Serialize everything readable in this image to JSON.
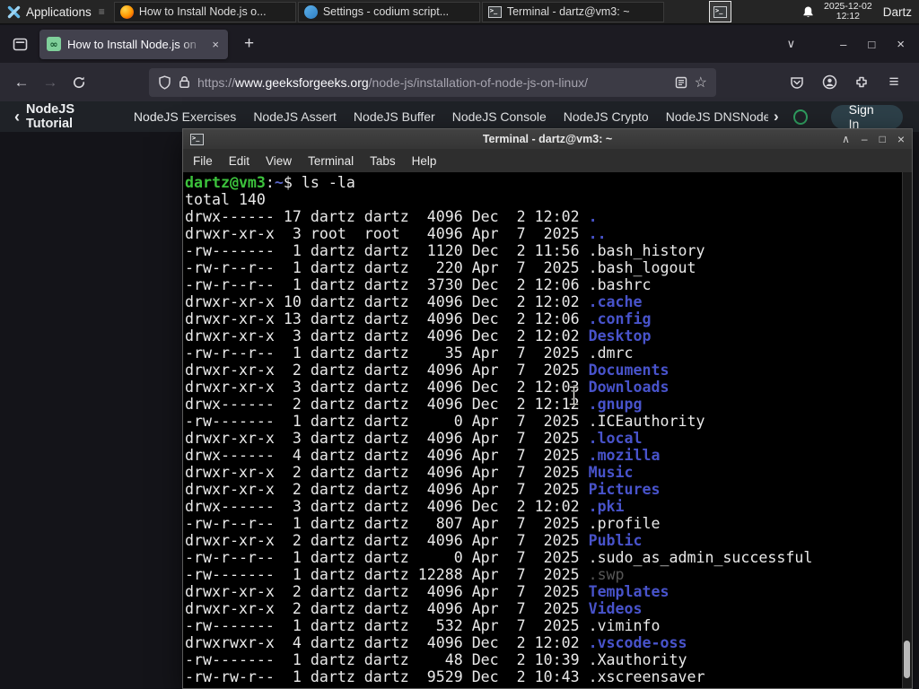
{
  "panel": {
    "applications_label": "Applications",
    "clock_date": "2025-12-02",
    "clock_time": "12:12",
    "user_label": "Dartz",
    "window_buttons": [
      {
        "icon": "firefox",
        "label": "How to Install Node.js o..."
      },
      {
        "icon": "vscodium",
        "label": "Settings - codium script..."
      },
      {
        "icon": "terminal",
        "label": "Terminal - dartz@vm3: ~"
      }
    ]
  },
  "browser": {
    "tab_title": "How to Install Node.js on",
    "tab_close_glyph": "×",
    "new_tab_glyph": "+",
    "controls": {
      "list_tabs": "∨",
      "minimize": "–",
      "maximize": "□",
      "close": "×"
    },
    "nav": {
      "back": "←",
      "forward": "→"
    },
    "url": {
      "scheme": "https://",
      "host": "www.geeksforgeeks.org",
      "path": "/node-js/installation-of-node-js-on-linux/"
    },
    "bookmark_star_glyph": "☆",
    "menu_glyph": "≡"
  },
  "site_nav": {
    "back_chevron": "‹",
    "back_label": "NodeJS Tutorial",
    "links": [
      "NodeJS Exercises",
      "NodeJS Assert",
      "NodeJS Buffer",
      "NodeJS Console",
      "NodeJS Crypto",
      "NodeJS DNS",
      "Node"
    ],
    "more_chevron": "›",
    "signin_label": "Sign In"
  },
  "terminal": {
    "title": "Terminal - dartz@vm3: ~",
    "menu": [
      "File",
      "Edit",
      "View",
      "Terminal",
      "Tabs",
      "Help"
    ],
    "controls": {
      "shade": "∧",
      "minimize": "–",
      "maximize": "□",
      "close": "×"
    },
    "prompt": {
      "user_host": "dartz@vm3",
      "colon": ":",
      "path": "~",
      "command": "$ ls -la"
    },
    "total_line": "total 140",
    "listing": [
      {
        "text": "drwx------ 17 dartz dartz  4096 Dec  2 12:02 ",
        "name": ".",
        "type": "dir"
      },
      {
        "text": "drwxr-xr-x  3 root  root   4096 Apr  7  2025 ",
        "name": "..",
        "type": "dir"
      },
      {
        "text": "-rw-------  1 dartz dartz  1120 Dec  2 11:56 ",
        "name": ".bash_history",
        "type": "file"
      },
      {
        "text": "-rw-r--r--  1 dartz dartz   220 Apr  7  2025 ",
        "name": ".bash_logout",
        "type": "file"
      },
      {
        "text": "-rw-r--r--  1 dartz dartz  3730 Dec  2 12:06 ",
        "name": ".bashrc",
        "type": "file"
      },
      {
        "text": "drwxr-xr-x 10 dartz dartz  4096 Dec  2 12:02 ",
        "name": ".cache",
        "type": "dir"
      },
      {
        "text": "drwxr-xr-x 13 dartz dartz  4096 Dec  2 12:06 ",
        "name": ".config",
        "type": "dir"
      },
      {
        "text": "drwxr-xr-x  3 dartz dartz  4096 Dec  2 12:02 ",
        "name": "Desktop",
        "type": "dir"
      },
      {
        "text": "-rw-r--r--  1 dartz dartz    35 Apr  7  2025 ",
        "name": ".dmrc",
        "type": "file"
      },
      {
        "text": "drwxr-xr-x  2 dartz dartz  4096 Apr  7  2025 ",
        "name": "Documents",
        "type": "dir"
      },
      {
        "text": "drwxr-xr-x  3 dartz dartz  4096 Dec  2 12:03 ",
        "name": "Downloads",
        "type": "dir"
      },
      {
        "text": "drwx------  2 dartz dartz  4096 Dec  2 12:12 ",
        "name": ".gnupg",
        "type": "dir"
      },
      {
        "text": "-rw-------  1 dartz dartz     0 Apr  7  2025 ",
        "name": ".ICEauthority",
        "type": "file"
      },
      {
        "text": "drwxr-xr-x  3 dartz dartz  4096 Apr  7  2025 ",
        "name": ".local",
        "type": "dir"
      },
      {
        "text": "drwx------  4 dartz dartz  4096 Apr  7  2025 ",
        "name": ".mozilla",
        "type": "dir"
      },
      {
        "text": "drwxr-xr-x  2 dartz dartz  4096 Apr  7  2025 ",
        "name": "Music",
        "type": "dir"
      },
      {
        "text": "drwxr-xr-x  2 dartz dartz  4096 Apr  7  2025 ",
        "name": "Pictures",
        "type": "dir"
      },
      {
        "text": "drwx------  3 dartz dartz  4096 Dec  2 12:02 ",
        "name": ".pki",
        "type": "dir"
      },
      {
        "text": "-rw-r--r--  1 dartz dartz   807 Apr  7  2025 ",
        "name": ".profile",
        "type": "file"
      },
      {
        "text": "drwxr-xr-x  2 dartz dartz  4096 Apr  7  2025 ",
        "name": "Public",
        "type": "dir"
      },
      {
        "text": "-rw-r--r--  1 dartz dartz     0 Apr  7  2025 ",
        "name": ".sudo_as_admin_successful",
        "type": "file"
      },
      {
        "text": "-rw-------  1 dartz dartz 12288 Apr  7  2025 ",
        "name": ".swp",
        "type": "dim"
      },
      {
        "text": "drwxr-xr-x  2 dartz dartz  4096 Apr  7  2025 ",
        "name": "Templates",
        "type": "dir"
      },
      {
        "text": "drwxr-xr-x  2 dartz dartz  4096 Apr  7  2025 ",
        "name": "Videos",
        "type": "dir"
      },
      {
        "text": "-rw-------  1 dartz dartz   532 Apr  7  2025 ",
        "name": ".viminfo",
        "type": "file"
      },
      {
        "text": "drwxrwxr-x  4 dartz dartz  4096 Dec  2 12:02 ",
        "name": ".vscode-oss",
        "type": "dir"
      },
      {
        "text": "-rw-------  1 dartz dartz    48 Dec  2 10:39 ",
        "name": ".Xauthority",
        "type": "file"
      },
      {
        "text": "-rw-rw-r--  1 dartz dartz  9529 Dec  2 10:43 ",
        "name": ".xscreensaver",
        "type": "file"
      }
    ]
  },
  "colors": {
    "panel_bg": "#252525",
    "firefox_chrome_bg": "#1c1b22",
    "firefox_toolbar_bg": "#2b2a33",
    "active_tab_bg": "#42414d",
    "site_nav_bg": "#1f2227",
    "gfg_green": "#2f9d5f",
    "terminal_bg": "#000000",
    "terminal_dir_blue": "#4853cb",
    "prompt_green": "#3cc23c",
    "swp_dim_gray": "#585858"
  }
}
